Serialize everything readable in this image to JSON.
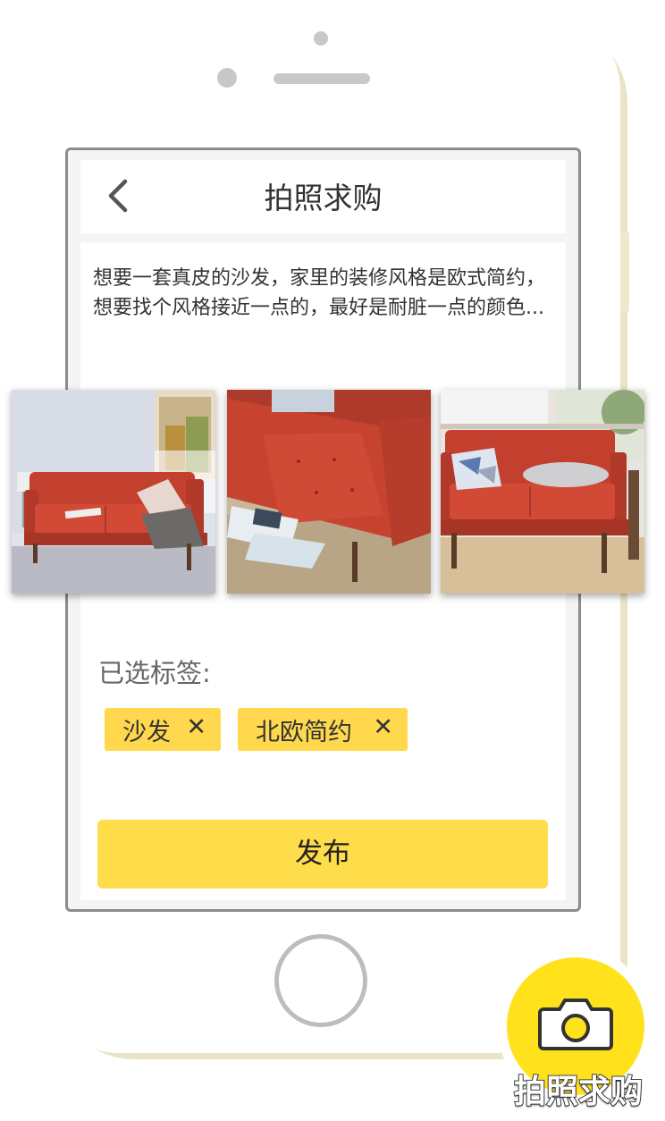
{
  "nav": {
    "title": "拍照求购",
    "back_icon": "chevron-left-icon"
  },
  "description": "想要一套真皮的沙发，家里的装修风格是欧式简约，想要找个风格接近一点的，最好是耐脏一点的颜色...",
  "photos": [
    {
      "name": "sofa-photo-living-room",
      "alt": "red sofa in living room"
    },
    {
      "name": "sofa-photo-closeup",
      "alt": "red sofa close-up with magazines"
    },
    {
      "name": "sofa-photo-front",
      "alt": "red sofa front view"
    }
  ],
  "tags": {
    "label": "已选标签:",
    "items": [
      {
        "text": "沙发",
        "remove": "✕"
      },
      {
        "text": "北欧简约",
        "remove": "✕"
      }
    ]
  },
  "publish_label": "发布",
  "fab": {
    "label": "拍照求购",
    "icon": "camera-icon"
  },
  "colors": {
    "accent": "#ffdc4a",
    "fab": "#ffe21c",
    "sofa": "#c8402f",
    "phone_frame": "#e9e4c8"
  }
}
